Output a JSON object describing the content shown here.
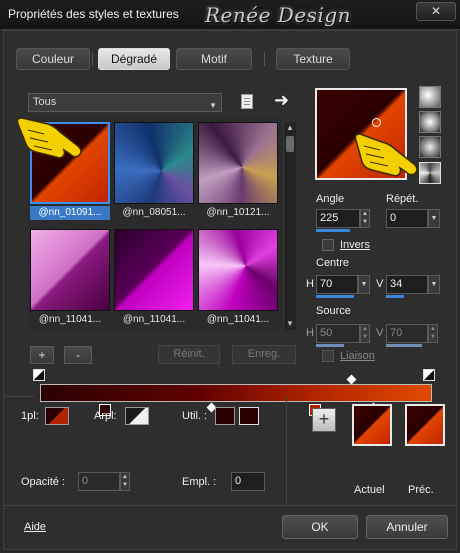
{
  "window": {
    "title": "Propriétés des styles et textures",
    "watermark": "Renée Design",
    "close": "✕"
  },
  "tabs": [
    {
      "label": "Couleur",
      "active": false
    },
    {
      "label": "Dégradé",
      "active": true
    },
    {
      "label": "Motif",
      "active": false
    },
    {
      "label": "Texture",
      "active": false
    }
  ],
  "category": {
    "value": "Tous"
  },
  "gradients": [
    {
      "label": "@nn_01091...",
      "selected": true
    },
    {
      "label": "@nn_08051...",
      "selected": false
    },
    {
      "label": "@nn_10121...",
      "selected": false
    },
    {
      "label": "@nn_11041...",
      "selected": false
    },
    {
      "label": "@nn_11041...",
      "selected": false
    },
    {
      "label": "@nn_11041...",
      "selected": false
    }
  ],
  "grid_buttons": {
    "add": "+",
    "remove": "-",
    "reset": "Réinit.",
    "save": "Enreg."
  },
  "props": {
    "angle_label": "Angle",
    "angle": "225",
    "repeat_label": "Répét.",
    "repeat": "0",
    "invert_label": "Invers",
    "center_label": "Centre",
    "center_h_label": "H",
    "center_h": "70",
    "center_v_label": "V",
    "center_v": "34",
    "source_label": "Source",
    "source_h_label": "H",
    "source_h": "50",
    "source_v_label": "V",
    "source_v": "70",
    "link_label": "Liaison"
  },
  "bottom": {
    "first_label": "1pl:",
    "arpl_label": "Arpl:",
    "util_label": "Util. :",
    "opacity_label": "Opacité :",
    "opacity": "0",
    "empl_label": "Empl. :",
    "empl": "0",
    "add": "+",
    "actuel": "Actuel",
    "prec": "Préc."
  },
  "footer": {
    "help": "Aide",
    "ok": "OK",
    "cancel": "Annuler"
  },
  "colors": {
    "accent": "#3a79c8",
    "dark_red": "#2a0000",
    "orange": "#e24500"
  }
}
